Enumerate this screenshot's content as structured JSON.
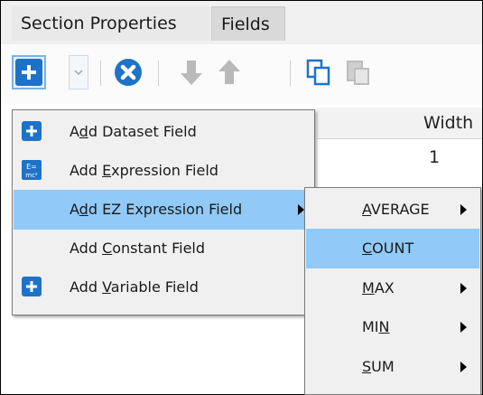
{
  "tabs": [
    {
      "label": "Section Properties"
    },
    {
      "label": "Fields"
    }
  ],
  "toolbar": {
    "icons": [
      "plus-icon",
      "dropdown-chevron-icon",
      "delete-icon",
      "move-down-icon",
      "move-up-icon",
      "copy-icon",
      "paste-icon"
    ]
  },
  "grid": {
    "column_header": "Width",
    "cell_value": "1"
  },
  "menu": {
    "items": [
      {
        "pre": "A",
        "key": "d",
        "post": "d Dataset Field",
        "icon": "plus-icon"
      },
      {
        "pre": "Add ",
        "key": "E",
        "post": "xpression Field",
        "icon": "expression-icon"
      },
      {
        "pre": "A",
        "key": "d",
        "post": "d EZ Expression Field",
        "has_submenu": true,
        "highlighted": true
      },
      {
        "pre": "Add ",
        "key": "C",
        "post": "onstant Field"
      },
      {
        "pre": "Add ",
        "key": "V",
        "post": "ariable Field",
        "icon": "plus-icon"
      }
    ]
  },
  "submenu": {
    "items": [
      {
        "pre": "",
        "key": "A",
        "post": "VERAGE",
        "has_submenu": true
      },
      {
        "pre": "",
        "key": "C",
        "post": "OUNT",
        "has_submenu": false,
        "highlighted": true
      },
      {
        "pre": "",
        "key": "M",
        "post": "AX",
        "has_submenu": true
      },
      {
        "pre": "MI",
        "key": "N",
        "post": "",
        "has_submenu": true
      },
      {
        "pre": "",
        "key": "S",
        "post": "UM",
        "has_submenu": true
      }
    ]
  },
  "colors": {
    "accent_blue": "#1e73c8",
    "highlight": "#91c9f7",
    "menu_bg": "#f0f0f0"
  }
}
